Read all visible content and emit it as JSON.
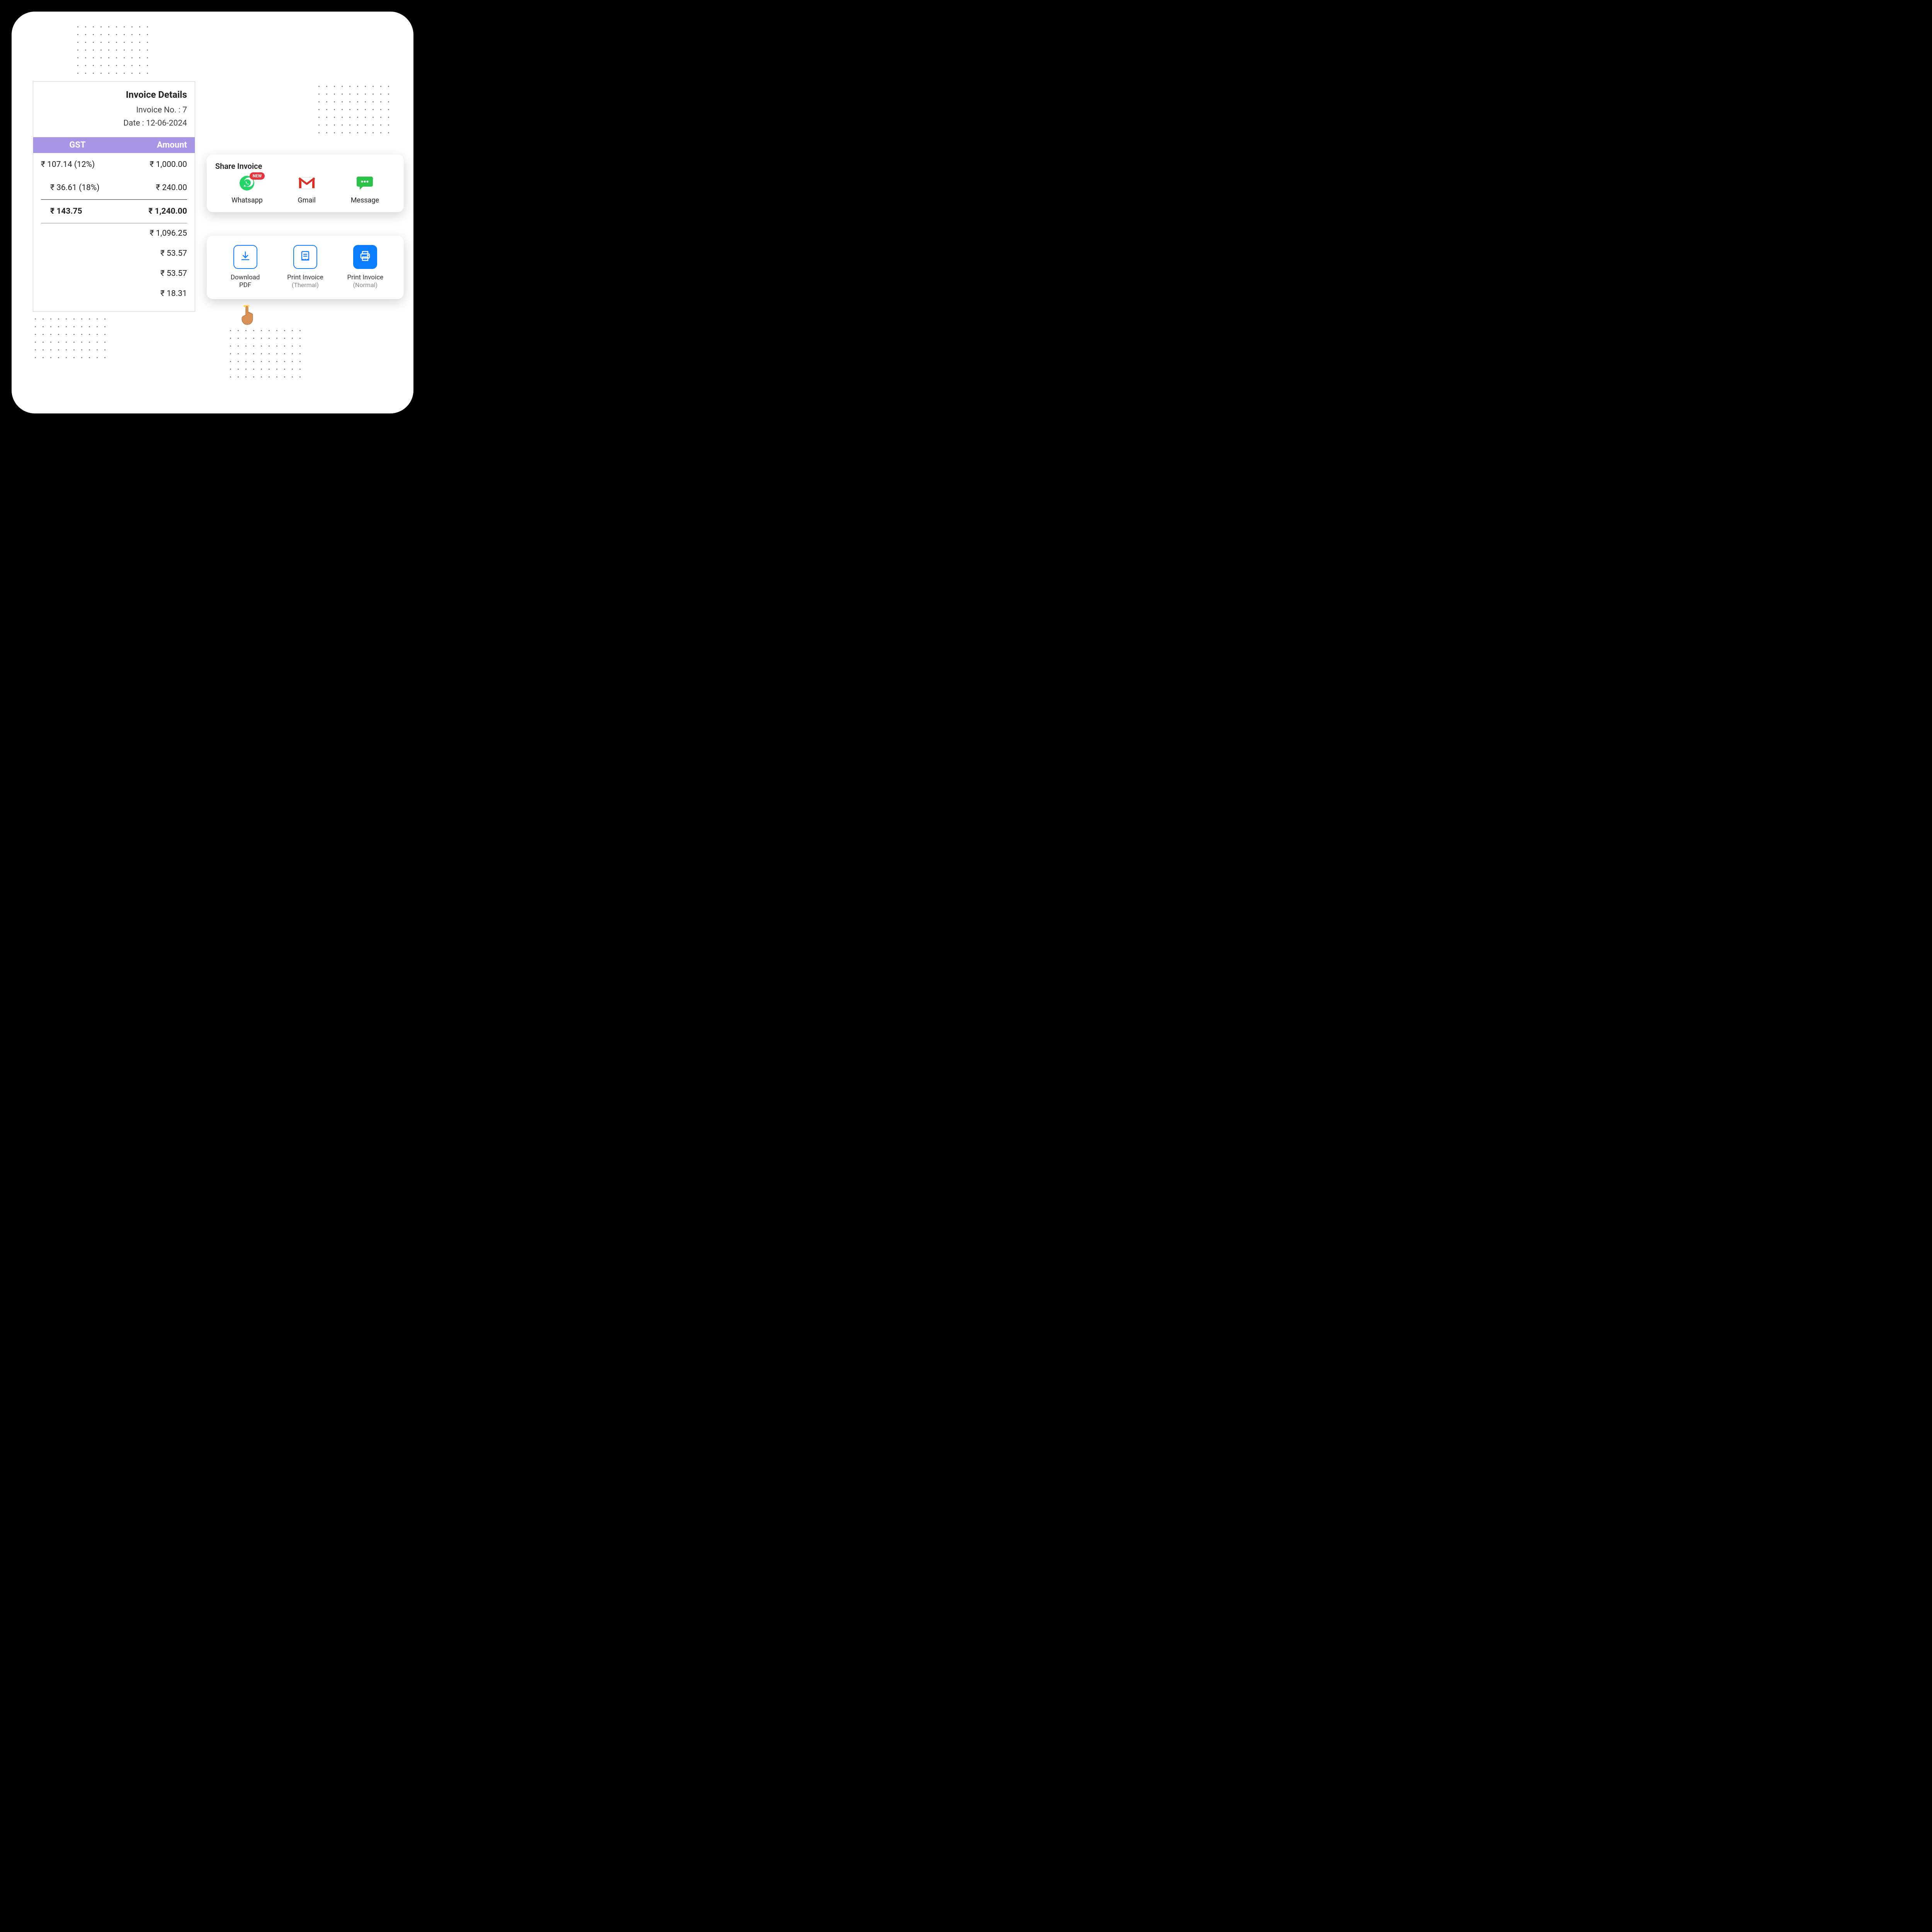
{
  "invoice": {
    "title": "Invoice Details",
    "number_label": "Invoice No. : 7",
    "date_label": "Date : 12-06-2024",
    "columns": {
      "gst": "GST",
      "amount": "Amount"
    },
    "rows": [
      {
        "gst": "₹ 107.14 (12%)",
        "amount": "₹ 1,000.00"
      },
      {
        "gst": "₹ 36.61 (18%)",
        "amount": "₹ 240.00"
      }
    ],
    "totals": {
      "gst": "₹ 143.75",
      "amount": "₹ 1,240.00"
    },
    "extras": [
      "₹ 1,096.25",
      "₹ 53.57",
      "₹ 53.57",
      "₹ 18.31"
    ]
  },
  "share": {
    "title": "Share Invoice",
    "items": [
      {
        "label": "Whatsapp",
        "badge": "NEW"
      },
      {
        "label": "Gmail"
      },
      {
        "label": "Message"
      }
    ]
  },
  "actions": {
    "items": [
      {
        "line1": "Download",
        "line2": "PDF",
        "style": "outline"
      },
      {
        "line1": "Print Invoice",
        "line2": "(Thermal)",
        "style": "outline"
      },
      {
        "line1": "Print Invoice",
        "line2": "(Normal)",
        "style": "solid"
      }
    ]
  }
}
